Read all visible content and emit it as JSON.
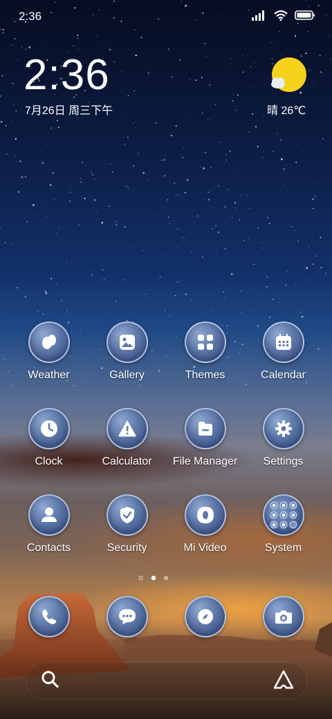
{
  "status_bar": {
    "time": "2:36"
  },
  "clock_widget": {
    "time": "2:36",
    "date": "7月26日 周三下午"
  },
  "weather_widget": {
    "text": "晴 26℃",
    "icon": "sun-cloud-icon"
  },
  "apps": [
    {
      "label": "Weather",
      "icon": "weather-drops-icon"
    },
    {
      "label": "Gallery",
      "icon": "image-icon"
    },
    {
      "label": "Themes",
      "icon": "grid-icon"
    },
    {
      "label": "Calendar",
      "icon": "calendar-icon"
    },
    {
      "label": "Clock",
      "icon": "clock-icon"
    },
    {
      "label": "Calculator",
      "icon": "warning-triangle-icon"
    },
    {
      "label": "File Manager",
      "icon": "folder-icon"
    },
    {
      "label": "Settings",
      "icon": "gear-icon"
    },
    {
      "label": "Contacts",
      "icon": "person-icon"
    },
    {
      "label": "Security",
      "icon": "shield-check-icon"
    },
    {
      "label": "Mi Video",
      "icon": "video-icon"
    },
    {
      "label": "System",
      "icon": "folder-grid-icon"
    }
  ],
  "dock": [
    {
      "icon": "phone-icon"
    },
    {
      "icon": "message-icon"
    },
    {
      "icon": "browser-compass-icon"
    },
    {
      "icon": "camera-icon"
    }
  ],
  "page_indicator": {
    "pages": 2,
    "current": 1
  },
  "search_bar": {
    "left_icon": "search-icon",
    "right_icon": "assistant-icon"
  }
}
